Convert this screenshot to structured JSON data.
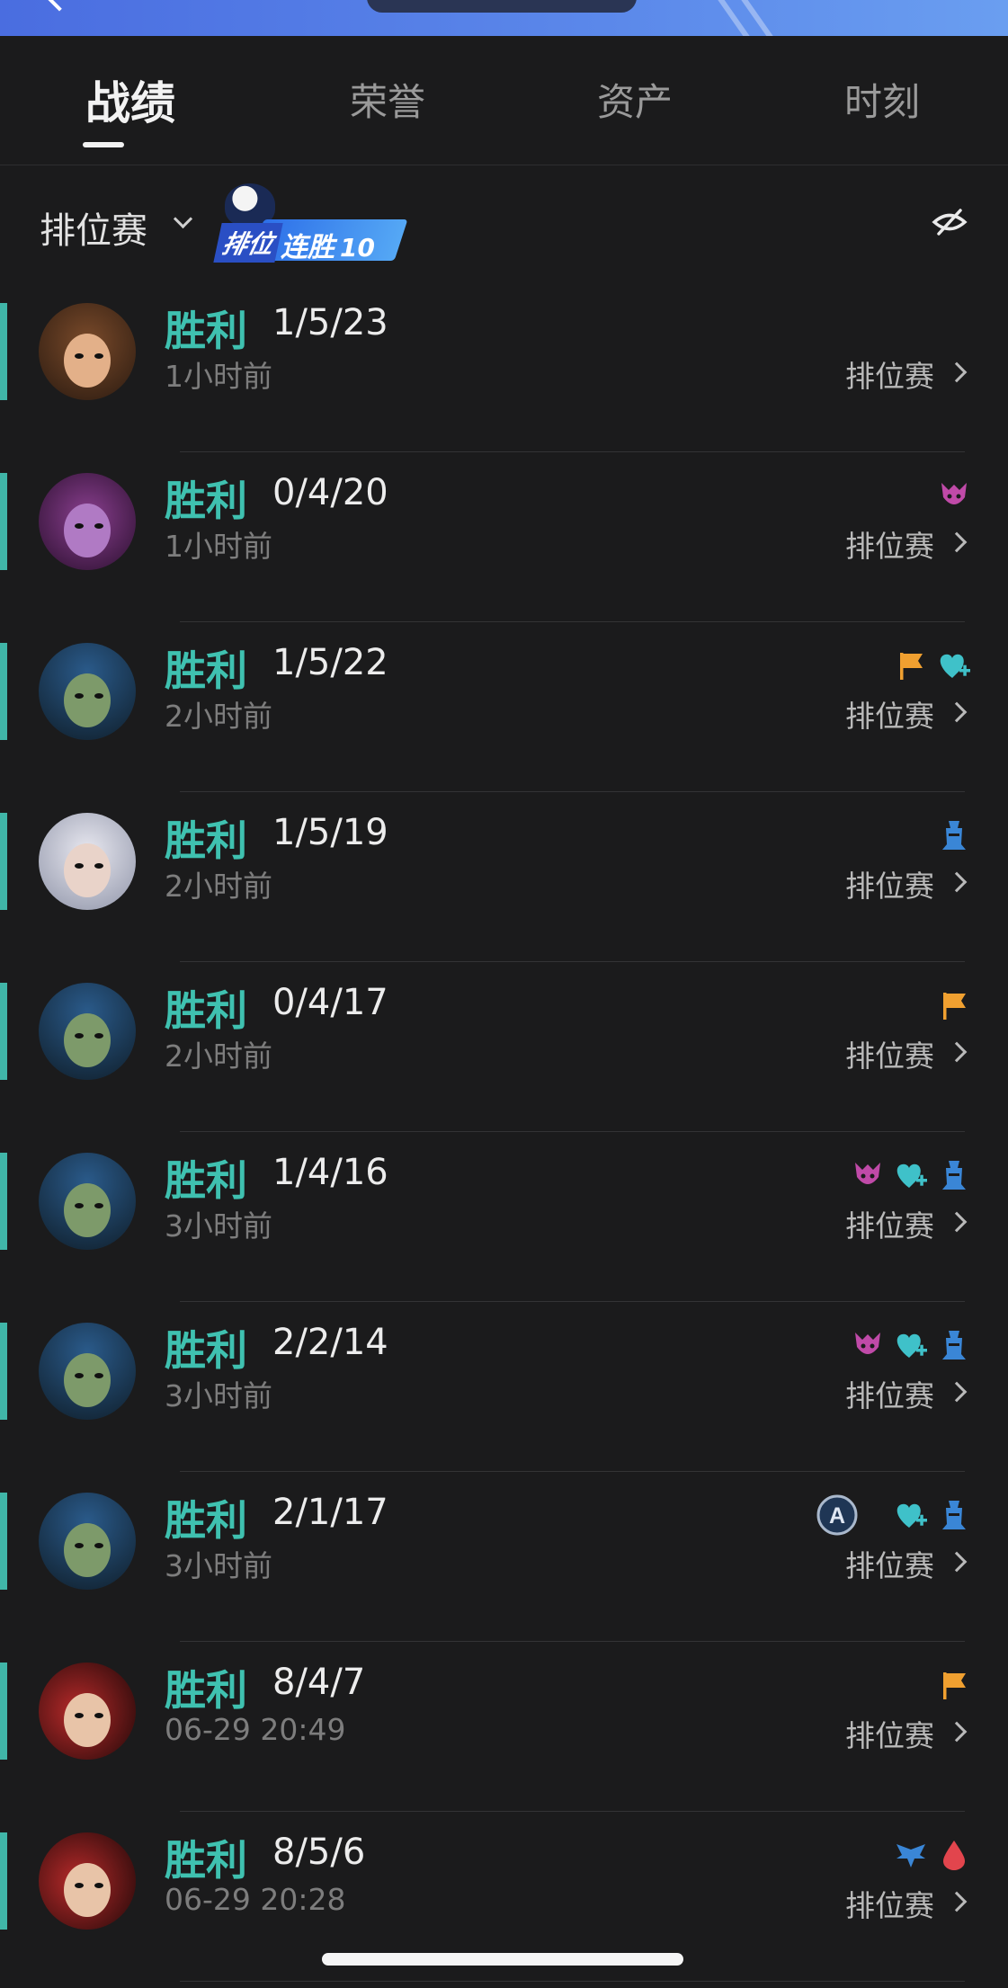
{
  "tabs": [
    {
      "label": "战绩",
      "active": true
    },
    {
      "label": "荣誉",
      "active": false
    },
    {
      "label": "资产",
      "active": false
    },
    {
      "label": "时刻",
      "active": false
    }
  ],
  "filter": {
    "label": "排位赛",
    "badge_tag": "排位",
    "badge_text": "连胜",
    "badge_count": "10"
  },
  "colors": {
    "accent": "#40b6a8",
    "win": "#3fc1b0",
    "background": "#1b1b1c"
  },
  "matches": [
    {
      "result": "胜利",
      "kda": "1/5/23",
      "time": "1小时前",
      "mode": "排位赛",
      "avatar": "brown-haired-champion-avatar",
      "icons": []
    },
    {
      "result": "胜利",
      "kda": "0/4/20",
      "time": "1小时前",
      "mode": "排位赛",
      "avatar": "purple-yordle-avatar",
      "icons": [
        "demon-icon"
      ]
    },
    {
      "result": "胜利",
      "kda": "1/5/22",
      "time": "2小时前",
      "mode": "排位赛",
      "avatar": "green-serpent-avatar",
      "icons": [
        "flag-icon",
        "heart-plus-icon"
      ]
    },
    {
      "result": "胜利",
      "kda": "1/5/19",
      "time": "2小时前",
      "mode": "排位赛",
      "avatar": "white-haired-avatar",
      "icons": [
        "tower-icon"
      ]
    },
    {
      "result": "胜利",
      "kda": "0/4/17",
      "time": "2小时前",
      "mode": "排位赛",
      "avatar": "green-serpent-avatar",
      "icons": [
        "flag-icon"
      ]
    },
    {
      "result": "胜利",
      "kda": "1/4/16",
      "time": "3小时前",
      "mode": "排位赛",
      "avatar": "green-serpent-avatar",
      "icons": [
        "demon-icon",
        "heart-plus-icon",
        "tower-icon"
      ]
    },
    {
      "result": "胜利",
      "kda": "2/2/14",
      "time": "3小时前",
      "mode": "排位赛",
      "avatar": "green-serpent-avatar",
      "icons": [
        "demon-icon",
        "heart-plus-icon",
        "tower-icon"
      ]
    },
    {
      "result": "胜利",
      "kda": "2/1/17",
      "time": "3小时前",
      "mode": "排位赛",
      "avatar": "green-serpent-avatar",
      "icons": [
        "a-badge-icon",
        "heart-plus-icon",
        "tower-icon"
      ]
    },
    {
      "result": "胜利",
      "kda": "8/4/7",
      "time": "06-29 20:49",
      "mode": "排位赛",
      "avatar": "red-haired-hat-avatar",
      "icons": [
        "flag-icon"
      ]
    },
    {
      "result": "胜利",
      "kda": "8/5/6",
      "time": "06-29 20:28",
      "mode": "排位赛",
      "avatar": "red-haired-hat-avatar",
      "icons": [
        "wings-icon",
        "blood-drop-icon"
      ]
    }
  ]
}
